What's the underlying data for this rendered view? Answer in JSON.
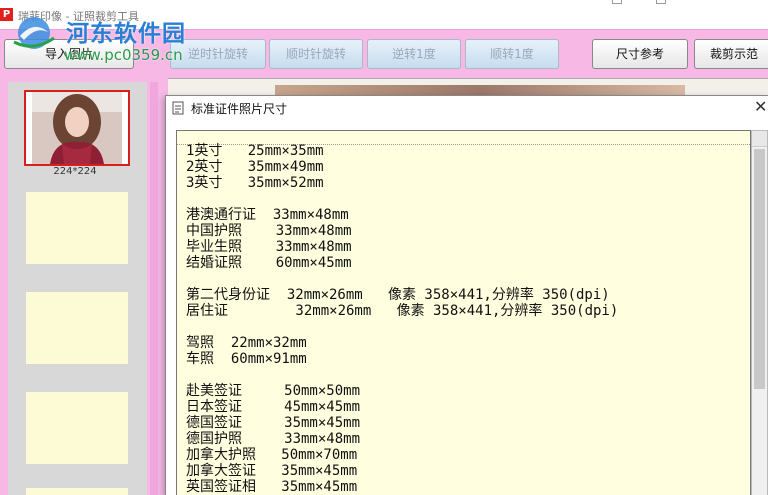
{
  "window": {
    "title": "瑞菲印像 - 证照裁剪工具",
    "icon_glyph": "P"
  },
  "watermark": {
    "site_name": "河东软件园",
    "url": "www.pc0359.cn"
  },
  "toolbar": {
    "import_label": "导入图片",
    "rotate_ccw_label": "逆时针旋转",
    "rotate_cw_label": "顺时针旋转",
    "rotate_ccw1_label": "逆转1度",
    "rotate_cw1_label": "顺转1度",
    "size_ref_label": "尺寸参考",
    "crop_sample_label": "裁剪示范"
  },
  "thumbnails": {
    "selected_label": "224*224"
  },
  "dialog": {
    "title": "标准证件照片尺寸",
    "groups": [
      [
        "1英寸   25mm×35mm",
        "2英寸   35mm×49mm",
        "3英寸   35mm×52mm"
      ],
      [
        "港澳通行证  33mm×48mm",
        "中国护照    33mm×48mm",
        "毕业生照    33mm×48mm",
        "结婚证照    60mm×45mm"
      ],
      [
        "第二代身份证  32mm×26mm   像素 358×441,分辨率 350(dpi)",
        "居住证        32mm×26mm   像素 358×441,分辨率 350(dpi)"
      ],
      [
        "驾照  22mm×32mm",
        "车照  60mm×91mm"
      ],
      [
        "赴美签证     50mm×50mm",
        "日本签证     45mm×45mm",
        "德国签证     35mm×45mm",
        "德国护照     33mm×48mm",
        "加拿大护照   50mm×70mm",
        "加拿大签证   35mm×45mm",
        "英国签证相   35mm×45mm"
      ]
    ]
  },
  "colors": {
    "background": "#f7b8e6",
    "text_area": "#ffffe0",
    "selection_border": "#d6201c"
  }
}
